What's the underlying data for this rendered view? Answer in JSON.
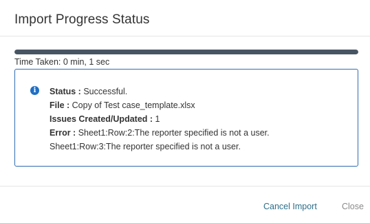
{
  "dialog": {
    "title": "Import Progress Status"
  },
  "progress": {
    "percent": 100,
    "time_taken": "Time Taken: 0 min, 1 sec"
  },
  "info": {
    "icon": "info-icon",
    "status_label": "Status :",
    "status_value": "Successful.",
    "file_label": "File :",
    "file_value": "Copy of Test case_template.xlsx",
    "issues_label": "Issues Created/Updated :",
    "issues_value": "1",
    "error_label": "Error :",
    "error_value_1": "Sheet1:Row:2:The reporter specified is not a user.",
    "error_value_2": "Sheet1:Row:3:The reporter specified is not a user."
  },
  "footer": {
    "cancel_label": "Cancel Import",
    "close_label": "Close"
  },
  "colors": {
    "progress_fill": "#475563",
    "info_border": "#2f6bb0",
    "info_icon": "#1f6fc5",
    "cancel_link": "#2c6e8a",
    "close_link": "#8a8a8a"
  }
}
